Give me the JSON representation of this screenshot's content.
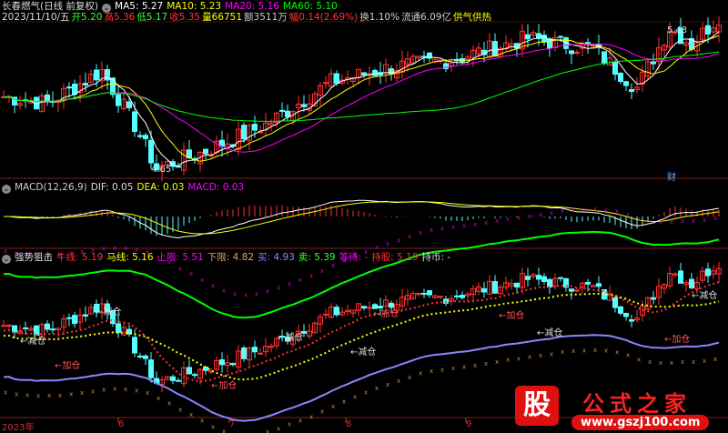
{
  "header": {
    "title": "长春燃气(日线 前复权)",
    "ma5": "MA5: 5.27",
    "ma10": "MA10: 5.23",
    "ma20": "MA20: 5.16",
    "ma60": "MA60: 5.10",
    "date": "2023/11/10/五",
    "open": "开5.20",
    "high": "高5.36",
    "low": "低5.17",
    "close": "收5.35",
    "vol": "量66751",
    "amount": "额3511万",
    "change": "幅0.14(2.69%)",
    "turnover": "换1.10%",
    "float": "流通6.09亿",
    "sector": "供气供热"
  },
  "annotations": {
    "high": "5.43",
    "low": "4.65",
    "cai": "财"
  },
  "macd": {
    "title": "MACD(12,26,9)",
    "dif": "DIF: 0.05",
    "dea": "DEA: 0.03",
    "macd": "MACD: 0.03"
  },
  "indicator": {
    "title": "强势狙击",
    "niu": "牛线: 5.19",
    "ma": "马线: 5.16",
    "upper": "上限: 5.51",
    "lower": "下限: 4.82",
    "buy": "买: 4.93",
    "sell": "卖: 5.39",
    "wait": "等待: -",
    "hold": "持股: 5.19",
    "coin": "持币: -",
    "labels": [
      "←减仓",
      "←加仓",
      "←减仓",
      "←加仓",
      "←减仓",
      "←加仓",
      "←减仓",
      "←加仓",
      "←减仓",
      "←加仓",
      "←减仓"
    ]
  },
  "axis": {
    "labels": [
      "2023年",
      "6",
      "7",
      "8",
      "9"
    ]
  },
  "logo": {
    "char": "股",
    "name": "公式之家",
    "url": "www.gszj100.com"
  },
  "price_keypoints": [
    [
      0,
      4.98
    ],
    [
      8,
      4.95
    ],
    [
      18,
      5.1
    ],
    [
      24,
      4.85
    ],
    [
      28,
      4.65
    ],
    [
      36,
      4.72
    ],
    [
      48,
      4.85
    ],
    [
      60,
      5.05
    ],
    [
      72,
      5.12
    ],
    [
      82,
      5.15
    ],
    [
      96,
      5.25
    ],
    [
      108,
      5.2
    ],
    [
      116,
      5.02
    ],
    [
      122,
      5.3
    ],
    [
      126,
      5.22
    ],
    [
      131,
      5.35
    ]
  ],
  "colors": {
    "up": "#ff3232",
    "down": "#54ffff",
    "ma5": "#ffffff",
    "ma10": "#ffff00",
    "ma20": "#ff00ff",
    "ma60": "#00ff00"
  }
}
